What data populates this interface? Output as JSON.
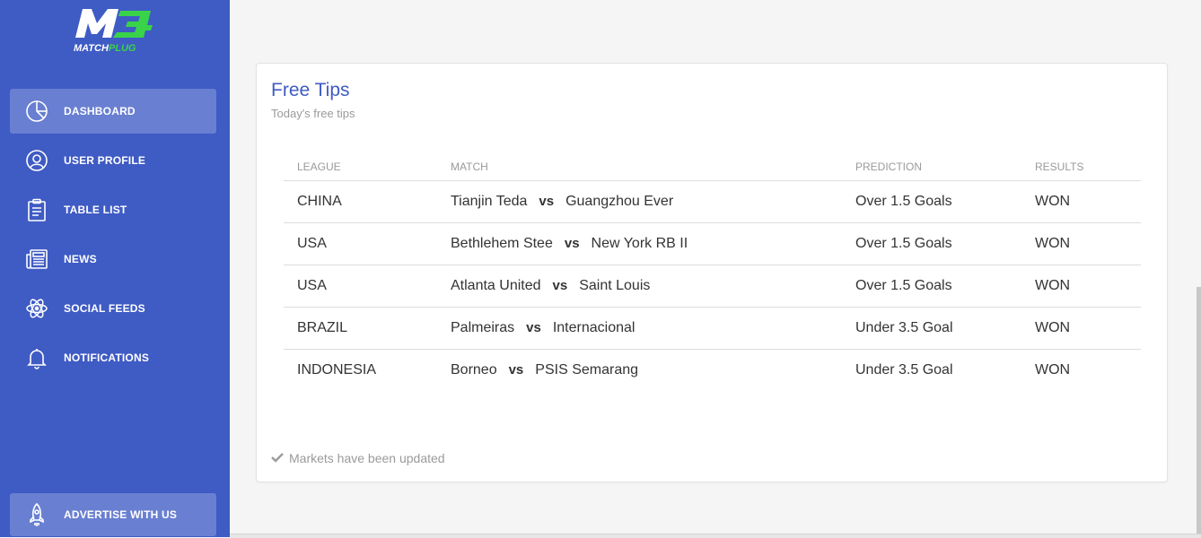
{
  "brand": {
    "logo_word_a": "MATCH",
    "logo_word_b": "PLUG",
    "accent": "#39d34a"
  },
  "sidebar": {
    "items": [
      {
        "label": "DASHBOARD",
        "icon": "pie-chart-icon",
        "active": true
      },
      {
        "label": "USER PROFILE",
        "icon": "user-icon"
      },
      {
        "label": "TABLE LIST",
        "icon": "clipboard-icon"
      },
      {
        "label": "NEWS",
        "icon": "newspaper-icon"
      },
      {
        "label": "SOCIAL FEEDS",
        "icon": "atom-icon"
      },
      {
        "label": "NOTIFICATIONS",
        "icon": "bell-icon"
      }
    ],
    "advertise": {
      "label": "ADVERTISE WITH US",
      "icon": "rocket-icon"
    }
  },
  "card": {
    "title": "Free Tips",
    "subtitle": "Today's free tips",
    "footer": "Markets have been updated",
    "columns": [
      "LEAGUE",
      "MATCH",
      "PREDICTION",
      "RESULTS"
    ],
    "vs_label": "vs",
    "rows": [
      {
        "league": "CHINA",
        "home": "Tianjin Teda",
        "away": "Guangzhou Ever",
        "prediction": "Over 1.5 Goals",
        "result": "WON"
      },
      {
        "league": "USA",
        "home": "Bethlehem Stee",
        "away": "New York RB II",
        "prediction": "Over 1.5 Goals",
        "result": "WON"
      },
      {
        "league": "USA",
        "home": "Atlanta United",
        "away": "Saint Louis",
        "prediction": "Over 1.5 Goals",
        "result": "WON"
      },
      {
        "league": "BRAZIL",
        "home": "Palmeiras",
        "away": "Internacional",
        "prediction": "Under 3.5 Goal",
        "result": "WON"
      },
      {
        "league": "INDONESIA",
        "home": "Borneo",
        "away": "PSIS Semarang",
        "prediction": "Under 3.5 Goal",
        "result": "WON"
      }
    ]
  },
  "colors": {
    "sidebar": "#3f5bc4",
    "title": "#3f5bc4"
  }
}
